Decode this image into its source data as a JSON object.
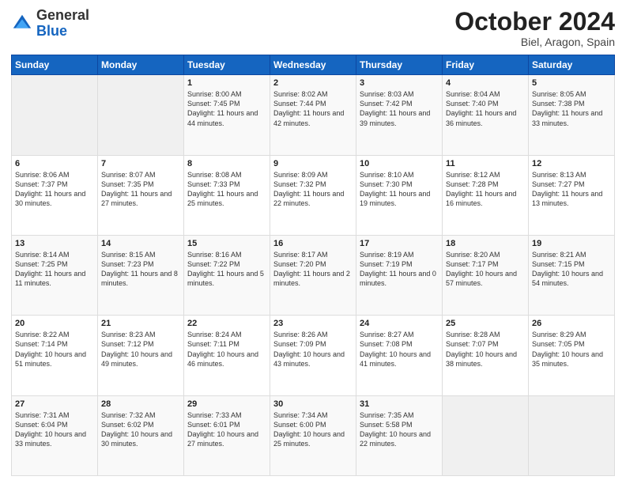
{
  "header": {
    "logo": {
      "line1": "General",
      "line2": "Blue"
    },
    "month_title": "October 2024",
    "subtitle": "Biel, Aragon, Spain"
  },
  "weekdays": [
    "Sunday",
    "Monday",
    "Tuesday",
    "Wednesday",
    "Thursday",
    "Friday",
    "Saturday"
  ],
  "weeks": [
    [
      {
        "day": "",
        "empty": true
      },
      {
        "day": "",
        "empty": true
      },
      {
        "day": "1",
        "sunrise": "Sunrise: 8:00 AM",
        "sunset": "Sunset: 7:45 PM",
        "daylight": "Daylight: 11 hours and 44 minutes."
      },
      {
        "day": "2",
        "sunrise": "Sunrise: 8:02 AM",
        "sunset": "Sunset: 7:44 PM",
        "daylight": "Daylight: 11 hours and 42 minutes."
      },
      {
        "day": "3",
        "sunrise": "Sunrise: 8:03 AM",
        "sunset": "Sunset: 7:42 PM",
        "daylight": "Daylight: 11 hours and 39 minutes."
      },
      {
        "day": "4",
        "sunrise": "Sunrise: 8:04 AM",
        "sunset": "Sunset: 7:40 PM",
        "daylight": "Daylight: 11 hours and 36 minutes."
      },
      {
        "day": "5",
        "sunrise": "Sunrise: 8:05 AM",
        "sunset": "Sunset: 7:38 PM",
        "daylight": "Daylight: 11 hours and 33 minutes."
      }
    ],
    [
      {
        "day": "6",
        "sunrise": "Sunrise: 8:06 AM",
        "sunset": "Sunset: 7:37 PM",
        "daylight": "Daylight: 11 hours and 30 minutes."
      },
      {
        "day": "7",
        "sunrise": "Sunrise: 8:07 AM",
        "sunset": "Sunset: 7:35 PM",
        "daylight": "Daylight: 11 hours and 27 minutes."
      },
      {
        "day": "8",
        "sunrise": "Sunrise: 8:08 AM",
        "sunset": "Sunset: 7:33 PM",
        "daylight": "Daylight: 11 hours and 25 minutes."
      },
      {
        "day": "9",
        "sunrise": "Sunrise: 8:09 AM",
        "sunset": "Sunset: 7:32 PM",
        "daylight": "Daylight: 11 hours and 22 minutes."
      },
      {
        "day": "10",
        "sunrise": "Sunrise: 8:10 AM",
        "sunset": "Sunset: 7:30 PM",
        "daylight": "Daylight: 11 hours and 19 minutes."
      },
      {
        "day": "11",
        "sunrise": "Sunrise: 8:12 AM",
        "sunset": "Sunset: 7:28 PM",
        "daylight": "Daylight: 11 hours and 16 minutes."
      },
      {
        "day": "12",
        "sunrise": "Sunrise: 8:13 AM",
        "sunset": "Sunset: 7:27 PM",
        "daylight": "Daylight: 11 hours and 13 minutes."
      }
    ],
    [
      {
        "day": "13",
        "sunrise": "Sunrise: 8:14 AM",
        "sunset": "Sunset: 7:25 PM",
        "daylight": "Daylight: 11 hours and 11 minutes."
      },
      {
        "day": "14",
        "sunrise": "Sunrise: 8:15 AM",
        "sunset": "Sunset: 7:23 PM",
        "daylight": "Daylight: 11 hours and 8 minutes."
      },
      {
        "day": "15",
        "sunrise": "Sunrise: 8:16 AM",
        "sunset": "Sunset: 7:22 PM",
        "daylight": "Daylight: 11 hours and 5 minutes."
      },
      {
        "day": "16",
        "sunrise": "Sunrise: 8:17 AM",
        "sunset": "Sunset: 7:20 PM",
        "daylight": "Daylight: 11 hours and 2 minutes."
      },
      {
        "day": "17",
        "sunrise": "Sunrise: 8:19 AM",
        "sunset": "Sunset: 7:19 PM",
        "daylight": "Daylight: 11 hours and 0 minutes."
      },
      {
        "day": "18",
        "sunrise": "Sunrise: 8:20 AM",
        "sunset": "Sunset: 7:17 PM",
        "daylight": "Daylight: 10 hours and 57 minutes."
      },
      {
        "day": "19",
        "sunrise": "Sunrise: 8:21 AM",
        "sunset": "Sunset: 7:15 PM",
        "daylight": "Daylight: 10 hours and 54 minutes."
      }
    ],
    [
      {
        "day": "20",
        "sunrise": "Sunrise: 8:22 AM",
        "sunset": "Sunset: 7:14 PM",
        "daylight": "Daylight: 10 hours and 51 minutes."
      },
      {
        "day": "21",
        "sunrise": "Sunrise: 8:23 AM",
        "sunset": "Sunset: 7:12 PM",
        "daylight": "Daylight: 10 hours and 49 minutes."
      },
      {
        "day": "22",
        "sunrise": "Sunrise: 8:24 AM",
        "sunset": "Sunset: 7:11 PM",
        "daylight": "Daylight: 10 hours and 46 minutes."
      },
      {
        "day": "23",
        "sunrise": "Sunrise: 8:26 AM",
        "sunset": "Sunset: 7:09 PM",
        "daylight": "Daylight: 10 hours and 43 minutes."
      },
      {
        "day": "24",
        "sunrise": "Sunrise: 8:27 AM",
        "sunset": "Sunset: 7:08 PM",
        "daylight": "Daylight: 10 hours and 41 minutes."
      },
      {
        "day": "25",
        "sunrise": "Sunrise: 8:28 AM",
        "sunset": "Sunset: 7:07 PM",
        "daylight": "Daylight: 10 hours and 38 minutes."
      },
      {
        "day": "26",
        "sunrise": "Sunrise: 8:29 AM",
        "sunset": "Sunset: 7:05 PM",
        "daylight": "Daylight: 10 hours and 35 minutes."
      }
    ],
    [
      {
        "day": "27",
        "sunrise": "Sunrise: 7:31 AM",
        "sunset": "Sunset: 6:04 PM",
        "daylight": "Daylight: 10 hours and 33 minutes."
      },
      {
        "day": "28",
        "sunrise": "Sunrise: 7:32 AM",
        "sunset": "Sunset: 6:02 PM",
        "daylight": "Daylight: 10 hours and 30 minutes."
      },
      {
        "day": "29",
        "sunrise": "Sunrise: 7:33 AM",
        "sunset": "Sunset: 6:01 PM",
        "daylight": "Daylight: 10 hours and 27 minutes."
      },
      {
        "day": "30",
        "sunrise": "Sunrise: 7:34 AM",
        "sunset": "Sunset: 6:00 PM",
        "daylight": "Daylight: 10 hours and 25 minutes."
      },
      {
        "day": "31",
        "sunrise": "Sunrise: 7:35 AM",
        "sunset": "Sunset: 5:58 PM",
        "daylight": "Daylight: 10 hours and 22 minutes."
      },
      {
        "day": "",
        "empty": true
      },
      {
        "day": "",
        "empty": true
      }
    ]
  ]
}
